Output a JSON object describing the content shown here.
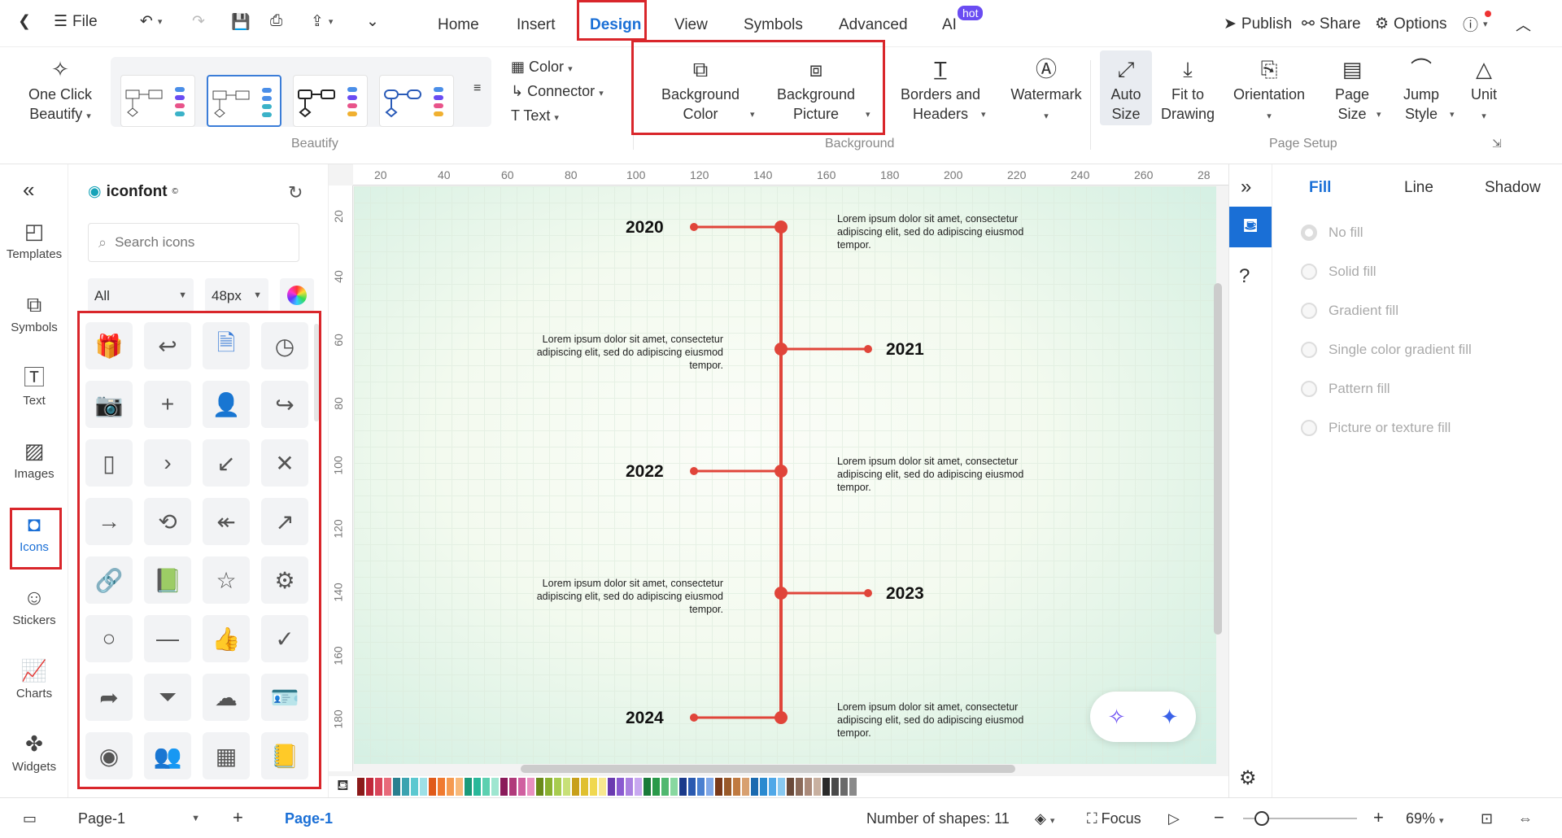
{
  "topbar": {
    "file": "File",
    "menus": [
      "Home",
      "Insert",
      "Design",
      "View",
      "Symbols",
      "Advanced",
      "AI"
    ],
    "hot": "hot",
    "publish": "Publish",
    "share": "Share",
    "options": "Options"
  },
  "ribbon": {
    "beautify": {
      "one_click": "One Click",
      "beautify": "Beautify",
      "color": "Color",
      "connector": "Connector",
      "text": "Text",
      "group": "Beautify"
    },
    "background": {
      "bg_color_1": "Background",
      "bg_color_2": "Color",
      "bg_pic_1": "Background",
      "bg_pic_2": "Picture",
      "borders_1": "Borders and",
      "borders_2": "Headers",
      "watermark": "Watermark",
      "group": "Background"
    },
    "page_setup": {
      "auto_1": "Auto",
      "auto_2": "Size",
      "fit_1": "Fit to",
      "fit_2": "Drawing",
      "orientation": "Orientation",
      "page_1": "Page",
      "page_2": "Size",
      "jump_1": "Jump",
      "jump_2": "Style",
      "unit": "Unit",
      "group": "Page Setup"
    }
  },
  "leftnav": [
    "Templates",
    "Symbols",
    "Text",
    "Images",
    "Icons",
    "Stickers",
    "Charts",
    "Widgets"
  ],
  "panel": {
    "brand": "iconfont",
    "search_placeholder": "Search icons",
    "filter": "All",
    "size": "48px"
  },
  "ruler": {
    "h": [
      "20",
      "40",
      "60",
      "80",
      "100",
      "120",
      "140",
      "160",
      "180",
      "200",
      "220",
      "240",
      "260",
      "28"
    ],
    "v": [
      "20",
      "40",
      "60",
      "80",
      "100",
      "120",
      "140",
      "160",
      "180"
    ]
  },
  "timeline": [
    {
      "year": "2020",
      "text": "Lorem ipsum dolor sit amet, consectetur adipiscing elit, sed do adipiscing eiusmod tempor."
    },
    {
      "year": "2021",
      "text": "Lorem ipsum dolor sit amet, consectetur adipiscing elit, sed do adipiscing eiusmod tempor."
    },
    {
      "year": "2022",
      "text": "Lorem ipsum dolor sit amet, consectetur adipiscing elit, sed do adipiscing eiusmod tempor."
    },
    {
      "year": "2023",
      "text": "Lorem ipsum dolor sit amet, consectetur adipiscing elit, sed do adipiscing eiusmod tempor."
    },
    {
      "year": "2024",
      "text": "Lorem ipsum dolor sit amet, consectetur adipiscing elit, sed do adipiscing eiusmod tempor."
    }
  ],
  "rightpanel": {
    "tabs": [
      "Fill",
      "Line",
      "Shadow"
    ],
    "options": [
      "No fill",
      "Solid fill",
      "Gradient fill",
      "Single color gradient fill",
      "Pattern fill",
      "Picture or texture fill"
    ]
  },
  "status": {
    "page_select": "Page-1",
    "page_tab": "Page-1",
    "shapes": "Number of shapes: 11",
    "focus": "Focus",
    "zoom": "69%"
  },
  "colors": {
    "accent": "#1a6fd6",
    "timeline": "#e0453a",
    "highlight": "#d9262b"
  }
}
